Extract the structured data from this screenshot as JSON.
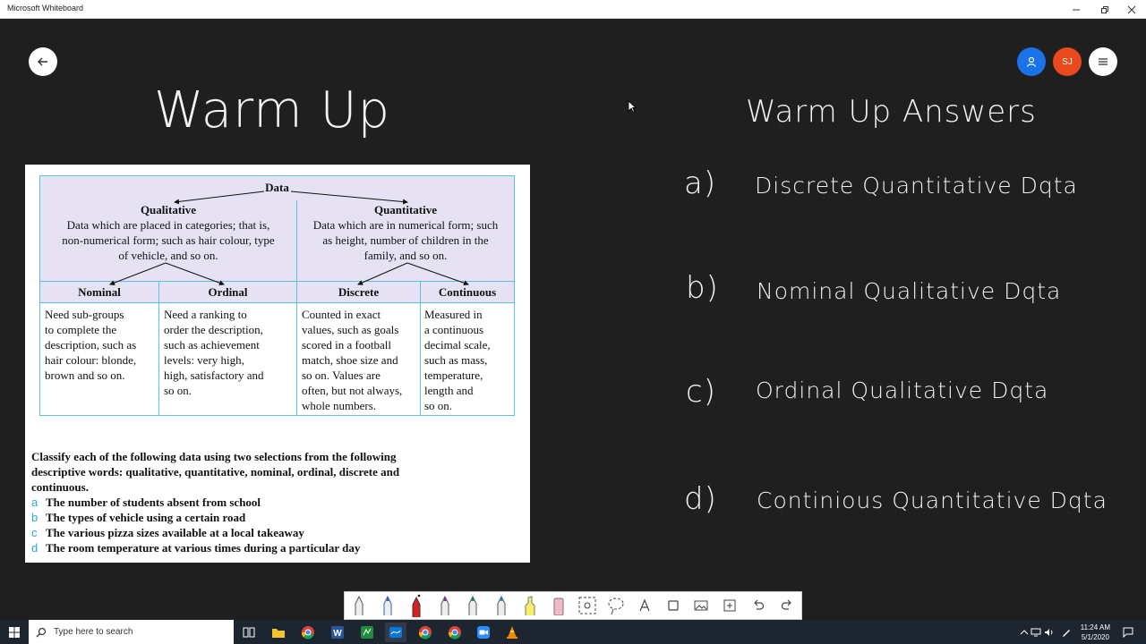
{
  "window": {
    "title": "Microsoft Whiteboard"
  },
  "header": {
    "avatar_initials": "SJ"
  },
  "board": {
    "warmup_title": "Warm Up",
    "answers_title": "Warm Up Answers",
    "answers": [
      {
        "label": "a)",
        "text": "Discrete Quantitative Dqta"
      },
      {
        "label": "b)",
        "text": "Nominal Qualitative Dqta"
      },
      {
        "label": "c)",
        "text": "Ordinal Qualitative Dqta"
      },
      {
        "label": "d)",
        "text": "Continious Quantitative Dqta"
      }
    ]
  },
  "document": {
    "table": {
      "root": "Data",
      "qualitative": {
        "title": "Qualitative",
        "desc_lines": [
          "Data which are placed in categories; that is,",
          "non-numerical form; such as hair colour, type",
          "of vehicle, and so on."
        ]
      },
      "quantitative": {
        "title": "Quantitative",
        "desc_lines": [
          "Data which are in numerical form; such",
          "as height, number of children in the",
          "family, and so on."
        ]
      },
      "columns": [
        "Nominal",
        "Ordinal",
        "Discrete",
        "Continuous"
      ],
      "cells": [
        [
          "Need sub-groups",
          "to complete the",
          "description, such as",
          "hair colour: blonde,",
          "brown and so on."
        ],
        [
          "Need a ranking to",
          "order the description,",
          "such as achievement",
          "levels: very high,",
          "high, satisfactory and",
          "so on."
        ],
        [
          "Counted in exact",
          "values, such as goals",
          "scored in a football",
          "match, shoe size and",
          "so on. Values are",
          "often, but not always,",
          "whole numbers."
        ],
        [
          "Measured in",
          "a continuous",
          "decimal scale,",
          "such as mass,",
          "temperature,",
          "length and",
          "so on."
        ]
      ]
    },
    "instructions_lines": [
      "Classify each of the following data using two selections from the following",
      "descriptive words: qualitative, quantitative, nominal, ordinal, discrete and",
      "continuous."
    ],
    "questions": [
      {
        "letter": "a",
        "text": "The number of students absent from school"
      },
      {
        "letter": "b",
        "text": "The types of vehicle using a certain road"
      },
      {
        "letter": "c",
        "text": "The various pizza sizes available at a local takeaway"
      },
      {
        "letter": "d",
        "text": "The room temperature at various times during a particular day"
      }
    ]
  },
  "taskbar": {
    "search_placeholder": "Type here to search",
    "time": "11:24 AM",
    "date": "5/1/2020"
  },
  "colors": {
    "accent_blue": "#1a73e8",
    "avatar_orange": "#e8491d",
    "table_border": "#5bc0e3",
    "table_header_bg": "#e6e1f3",
    "taskbar_bg": "#1c2530"
  }
}
